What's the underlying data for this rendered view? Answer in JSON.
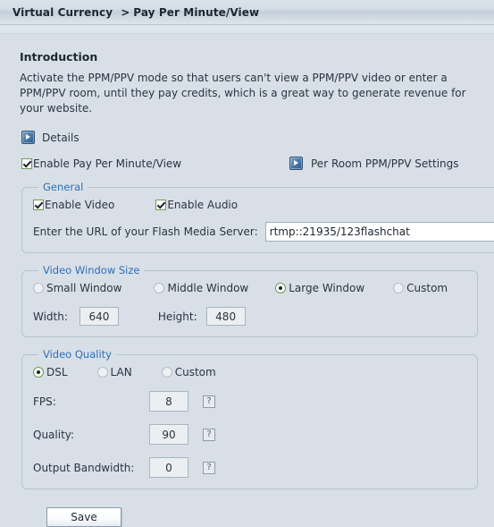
{
  "titlebar": {
    "breadcrumb_root": "Virtual Currency",
    "breadcrumb_separator": ">",
    "breadcrumb_current": "Pay Per Minute/View"
  },
  "intro": {
    "heading": "Introduction",
    "text": "Activate the PPM/PPV mode so that users can't view a PPM/PPV video or enter a PPM/PPV room, until they pay credits, which is a great way to generate revenue for your website."
  },
  "details": {
    "label": "Details",
    "icon": "play-expand-icon"
  },
  "enable_row": {
    "enable_ppm_label": "Enable Pay Per Minute/View",
    "enable_ppm_checked": true,
    "per_room_label": "Per Room PPM/PPV Settings",
    "per_room_icon": "play-expand-icon"
  },
  "general": {
    "legend": "General",
    "enable_video_label": "Enable Video",
    "enable_video_checked": true,
    "enable_audio_label": "Enable Audio",
    "enable_audio_checked": true,
    "url_label": "Enter the URL of your Flash Media Server:",
    "url_value": "rtmp::21935/123flashchat",
    "url_placeholder": ""
  },
  "video_window_size": {
    "legend": "Video Window Size",
    "options": [
      {
        "label": "Small Window",
        "selected": false
      },
      {
        "label": "Middle Window",
        "selected": false
      },
      {
        "label": "Large Window",
        "selected": true
      },
      {
        "label": "Custom",
        "selected": false
      }
    ],
    "width_label": "Width:",
    "width_value": "640",
    "height_label": "Height:",
    "height_value": "480"
  },
  "video_quality": {
    "legend": "Video Quality",
    "options": [
      {
        "label": "DSL",
        "selected": true
      },
      {
        "label": "LAN",
        "selected": false
      },
      {
        "label": "Custom",
        "selected": false
      }
    ],
    "fps_label": "FPS:",
    "fps_value": "8",
    "quality_label": "Quality:",
    "quality_value": "90",
    "bandwidth_label": "Output Bandwidth:",
    "bandwidth_value": "0",
    "help_glyph": "?"
  },
  "footer": {
    "save_label": "Save"
  },
  "colors": {
    "page_background": "#d8dfe7",
    "legend_blue": "#2f6fb5",
    "check_green": "#6f9b56",
    "text": "#2b3440",
    "border": "#b9c4d0"
  }
}
